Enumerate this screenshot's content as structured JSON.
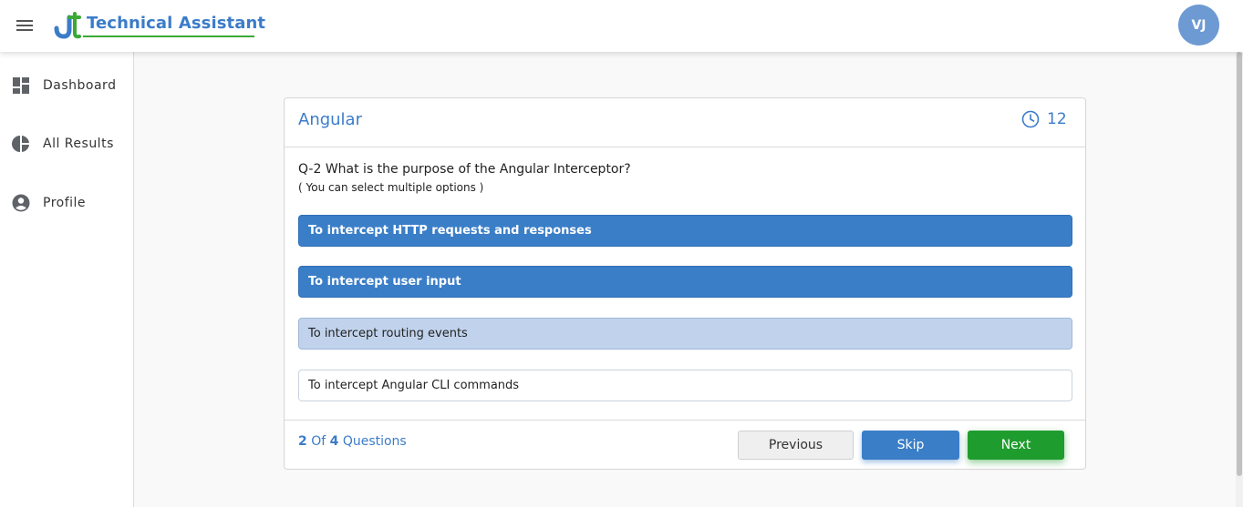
{
  "header": {
    "brand": "Technical Assistant",
    "avatar_initials": "VJ",
    "menu_icon": "hamburger-icon",
    "logo_icon": "jt-logo-icon"
  },
  "sidebar": {
    "items": [
      {
        "label": "Dashboard",
        "icon": "dashboard-icon"
      },
      {
        "label": "All Results",
        "icon": "pie-chart-icon"
      },
      {
        "label": "Profile",
        "icon": "account-circle-icon"
      }
    ]
  },
  "quiz": {
    "subject": "Angular",
    "timer": "12",
    "timer_icon": "clock-icon",
    "question": "Q-2 What is the purpose of the Angular Interceptor?",
    "hint": "( You can select multiple options )",
    "options": [
      {
        "label": "To intercept HTTP requests and responses",
        "state": "selected"
      },
      {
        "label": "To intercept user input",
        "state": "selected"
      },
      {
        "label": "To intercept routing events",
        "state": "hover"
      },
      {
        "label": "To intercept Angular CLI commands",
        "state": "unselected"
      }
    ],
    "progress": {
      "current": "2",
      "of_text": "Of",
      "total": "4",
      "suffix": "Questions"
    },
    "buttons": {
      "previous": "Previous",
      "skip": "Skip",
      "next": "Next"
    }
  },
  "colors": {
    "primary": "#3a7ec8",
    "success": "#1f9c2e",
    "hover_option": "#c1d3ec",
    "brand_underline": "#3aaa35"
  }
}
